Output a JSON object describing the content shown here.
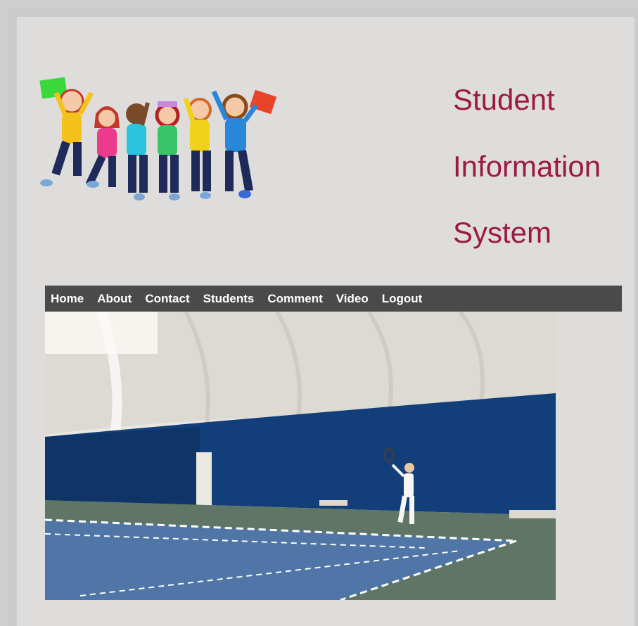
{
  "header": {
    "title_lines": [
      "Student",
      "Information",
      "System"
    ],
    "logo_icon": "jumping-students-logo"
  },
  "nav": {
    "items": [
      {
        "label": "Home"
      },
      {
        "label": "About"
      },
      {
        "label": "Contact"
      },
      {
        "label": "Students"
      },
      {
        "label": "Comment"
      },
      {
        "label": "Video"
      },
      {
        "label": "Logout"
      }
    ]
  },
  "colors": {
    "title": "#9c1a3f",
    "nav_bg": "#4a4a4a",
    "panel_bg": "#dedddb"
  },
  "media": {
    "type": "video",
    "subject": "tennis-court-video"
  }
}
